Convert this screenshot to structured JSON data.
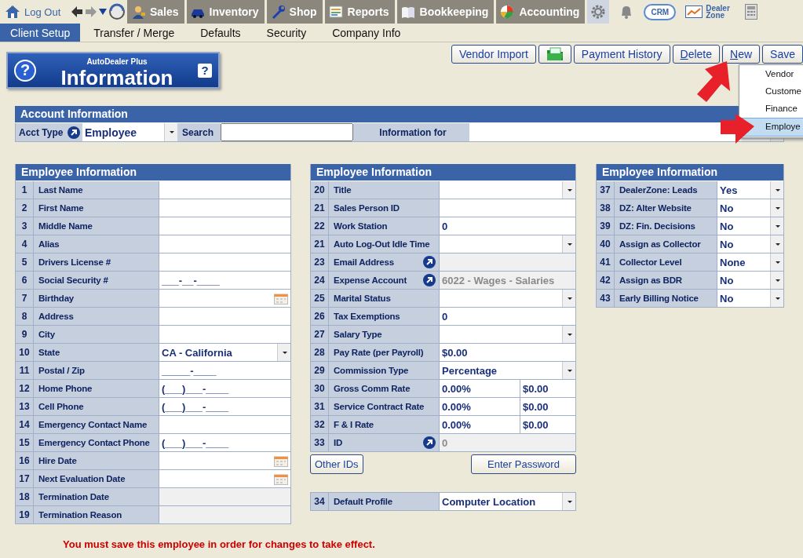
{
  "nav": {
    "logout": "Log Out",
    "modules": [
      "Sales",
      "Inventory",
      "Shop",
      "Reports",
      "Bookkeeping",
      "Accounting"
    ],
    "crm": "CRM",
    "dealer_zone": "Dealer Zone"
  },
  "subtabs": [
    {
      "label": "Client Setup",
      "selected": true
    },
    {
      "label": "Transfer / Merge",
      "selected": false
    },
    {
      "label": "Defaults",
      "selected": false
    },
    {
      "label": "Security",
      "selected": false
    },
    {
      "label": "Company Info",
      "selected": false
    }
  ],
  "logo": {
    "brand": "AutoDealer Plus",
    "title": "Information",
    "marks": [
      "?",
      "?"
    ]
  },
  "buttons": [
    {
      "kind": "text",
      "label": "Vendor Import",
      "underline_first": false
    },
    {
      "kind": "icon"
    },
    {
      "kind": "text",
      "label": "Payment History",
      "underline_first": false
    },
    {
      "kind": "text",
      "label": "Delete",
      "underline_first": true
    },
    {
      "kind": "text",
      "label": "New",
      "underline_first": true
    },
    {
      "kind": "text",
      "label": "Save",
      "underline_first": false
    }
  ],
  "new_menu": [
    {
      "label": "Vendor",
      "selected": false
    },
    {
      "label": "Custome",
      "selected": false
    },
    {
      "label": "Finance",
      "selected": false
    },
    {
      "label": "Employe",
      "selected": true
    }
  ],
  "account": {
    "title": "Account Information",
    "acct_type_label": "Acct Type",
    "acct_type": "Employee",
    "search_label": "Search",
    "info_for_label": "Information for"
  },
  "panels": [
    {
      "title": "Employee Information",
      "rows": [
        {
          "num": "1",
          "label": "Last Name",
          "kind": "text"
        },
        {
          "num": "2",
          "label": "First Name",
          "kind": "text"
        },
        {
          "num": "3",
          "label": "Middle Name",
          "kind": "text"
        },
        {
          "num": "4",
          "label": "Alias",
          "kind": "text"
        },
        {
          "num": "5",
          "label": "Drivers License #",
          "kind": "text"
        },
        {
          "num": "6",
          "label": "Social Security #",
          "kind": "text",
          "value": "___-__-____"
        },
        {
          "num": "7",
          "label": "Birthday",
          "kind": "date"
        },
        {
          "num": "8",
          "label": "Address",
          "kind": "text"
        },
        {
          "num": "9",
          "label": "City",
          "kind": "text"
        },
        {
          "num": "10",
          "label": "State",
          "kind": "select",
          "value": "CA - California"
        },
        {
          "num": "11",
          "label": "Postal / Zip",
          "kind": "text",
          "value": "_____-____"
        },
        {
          "num": "12",
          "label": "Home Phone",
          "kind": "text",
          "value": "(___)___-____"
        },
        {
          "num": "13",
          "label": "Cell Phone",
          "kind": "text",
          "value": "(___)___-____"
        },
        {
          "num": "14",
          "label": "Emergency Contact Name",
          "kind": "text"
        },
        {
          "num": "15",
          "label": "Emergency Contact Phone",
          "kind": "text",
          "value": "(___)___-____"
        },
        {
          "num": "16",
          "label": "Hire Date",
          "kind": "date"
        },
        {
          "num": "17",
          "label": "Next Evaluation Date",
          "kind": "date"
        },
        {
          "num": "18",
          "label": "Termination Date",
          "kind": "disabled"
        },
        {
          "num": "19",
          "label": "Termination Reason",
          "kind": "disabled"
        }
      ]
    },
    {
      "title": "Employee Information",
      "rows": [
        {
          "num": "20",
          "label": "Title",
          "kind": "select"
        },
        {
          "num": "21",
          "label": "Sales Person ID",
          "kind": "text"
        },
        {
          "num": "22",
          "label": "Work Station",
          "kind": "text",
          "value": "0"
        },
        {
          "num": "21",
          "label": "Auto Log-Out Idle Time",
          "kind": "select"
        },
        {
          "num": "23",
          "label": "Email Address",
          "kind": "lookup"
        },
        {
          "num": "24",
          "label": "Expense Account",
          "kind": "lookup",
          "value": "6022 - Wages - Salaries"
        },
        {
          "num": "25",
          "label": "Marital Status",
          "kind": "select"
        },
        {
          "num": "26",
          "label": "Tax Exemptions",
          "kind": "text",
          "value": "0"
        },
        {
          "num": "27",
          "label": "Salary Type",
          "kind": "select"
        },
        {
          "num": "28",
          "label": "Pay Rate (per Payroll)",
          "kind": "text",
          "value": "$0.00"
        },
        {
          "num": "29",
          "label": "Commission Type",
          "kind": "select",
          "value": "Percentage"
        },
        {
          "num": "30",
          "label": "Gross Comm Rate",
          "kind": "split",
          "value": "0.00%",
          "value2": "$0.00"
        },
        {
          "num": "31",
          "label": "Service Contract Rate",
          "kind": "split",
          "value": "0.00%",
          "value2": "$0.00"
        },
        {
          "num": "32",
          "label": "F & I Rate",
          "kind": "split",
          "value": "0.00%",
          "value2": "$0.00"
        },
        {
          "num": "33",
          "label": "ID",
          "kind": "lookup",
          "value": "0"
        }
      ],
      "buttons": [
        "Other IDs",
        "Enter Password"
      ],
      "extra_rows": [
        {
          "num": "34",
          "label": "Default Profile",
          "kind": "select",
          "value": "Computer Location"
        }
      ]
    },
    {
      "title": "Employee Information",
      "rows": [
        {
          "num": "37",
          "label": "DealerZone:  Leads",
          "kind": "select",
          "value": "Yes"
        },
        {
          "num": "38",
          "label": "DZ: Alter Website",
          "kind": "select",
          "value": "No"
        },
        {
          "num": "39",
          "label": "DZ: Fin. Decisions",
          "kind": "select",
          "value": "No"
        },
        {
          "num": "40",
          "label": "Assign as Collector",
          "kind": "select",
          "value": "No"
        },
        {
          "num": "41",
          "label": "Collector Level",
          "kind": "select",
          "value": "None"
        },
        {
          "num": "42",
          "label": "Assign as BDR",
          "kind": "select",
          "value": "No"
        },
        {
          "num": "43",
          "label": "Early Billing Notice",
          "kind": "select",
          "value": "No"
        }
      ]
    }
  ],
  "warning": "You must save this employee in order for changes to take effect."
}
